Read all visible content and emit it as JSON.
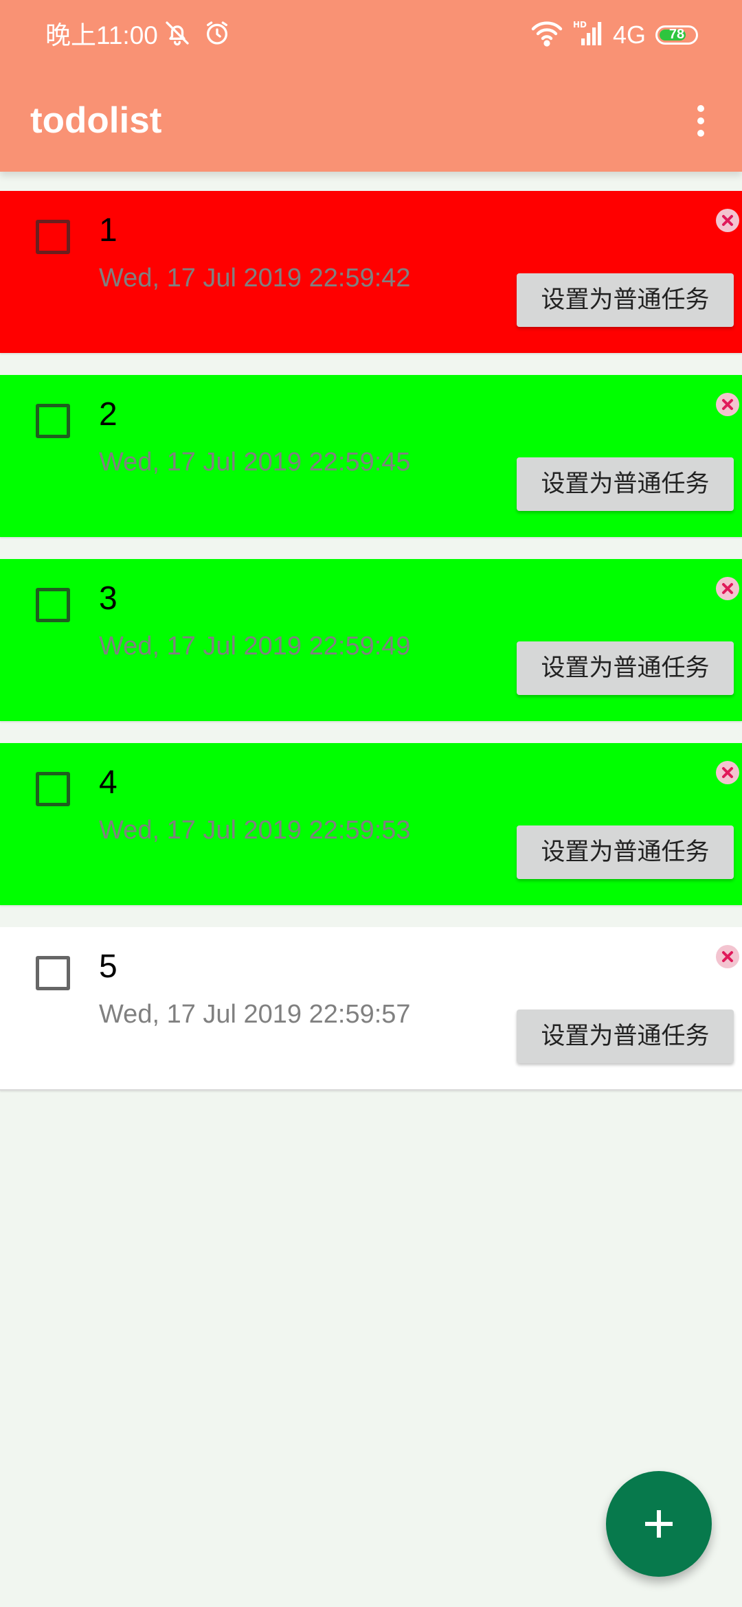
{
  "status_bar": {
    "time": "晚上11:00",
    "network": "4G",
    "battery": "78",
    "battery_level": 0.78
  },
  "app_bar": {
    "title": "todolist",
    "overflow_icon": "more-vert-icon"
  },
  "tasks": [
    {
      "title": "1",
      "date": "Wed, 17 Jul 2019 22:59:42",
      "action_label": "设置为普通任务",
      "checked": false,
      "color": "#ff0000"
    },
    {
      "title": "2",
      "date": "Wed, 17 Jul 2019 22:59:45",
      "action_label": "设置为普通任务",
      "checked": false,
      "color": "#00ff00"
    },
    {
      "title": "3",
      "date": "Wed, 17 Jul 2019 22:59:49",
      "action_label": "设置为普通任务",
      "checked": false,
      "color": "#00ff00"
    },
    {
      "title": "4",
      "date": "Wed, 17 Jul 2019 22:59:53",
      "action_label": "设置为普通任务",
      "checked": false,
      "color": "#00ff00"
    },
    {
      "title": "5",
      "date": "Wed, 17 Jul 2019 22:59:57",
      "action_label": "设置为普通任务",
      "checked": false,
      "color": "#ffffff"
    }
  ],
  "fab": {
    "icon": "add-icon"
  },
  "colors": {
    "app_bar": "#f99274",
    "background": "#f1f6f0",
    "fab": "#07794c",
    "delete_icon": "#e0195a"
  }
}
